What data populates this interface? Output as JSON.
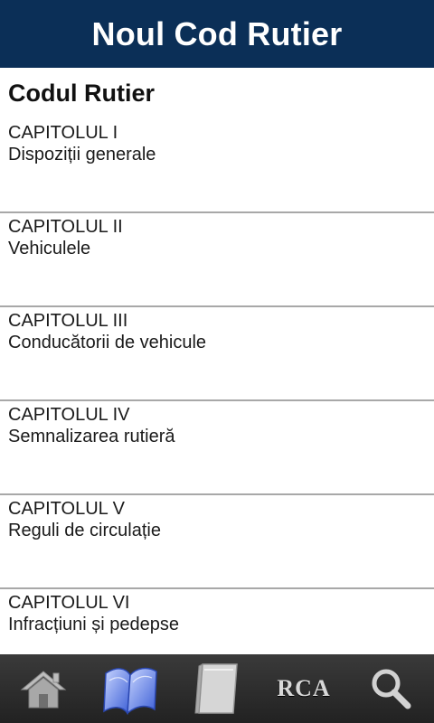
{
  "header": {
    "title": "Noul Cod Rutier"
  },
  "section": {
    "title": "Codul Rutier"
  },
  "chapters": [
    {
      "label": "CAPITOLUL I",
      "title": "Dispoziții generale"
    },
    {
      "label": "CAPITOLUL II",
      "title": "Vehiculele"
    },
    {
      "label": "CAPITOLUL III",
      "title": "Conducătorii de vehicule"
    },
    {
      "label": "CAPITOLUL IV",
      "title": "Semnalizarea rutieră"
    },
    {
      "label": "CAPITOLUL V",
      "title": "Reguli de circulație"
    },
    {
      "label": "CAPITOLUL VI",
      "title": "Infracțiuni și pedepse"
    }
  ],
  "tabbar": {
    "items": [
      {
        "icon": "home-icon"
      },
      {
        "icon": "open-book-icon",
        "selected": true
      },
      {
        "icon": "closed-book-icon"
      },
      {
        "icon": "rca-icon",
        "label": "RCA"
      },
      {
        "icon": "search-icon"
      }
    ]
  },
  "colors": {
    "header_bg": "#0b2f57",
    "tabbar_bg": "#2b2b2b",
    "selected_tab": "#4a6bd8"
  }
}
